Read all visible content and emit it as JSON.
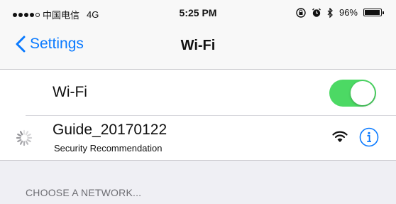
{
  "status_bar": {
    "carrier": "中国电信",
    "network_type": "4G",
    "time": "5:25 PM",
    "battery_percent": "96%",
    "battery_level": 0.96,
    "signal_bars_filled": 4,
    "signal_bars_total": 5,
    "icons": [
      "lock-rotation-icon",
      "alarm-icon",
      "bluetooth-icon",
      "battery-icon"
    ]
  },
  "nav": {
    "back_label": "Settings",
    "title": "Wi-Fi"
  },
  "wifi": {
    "label": "Wi-Fi",
    "enabled": true
  },
  "current_network": {
    "name": "Guide_20170122",
    "subtitle": "Security Recommendation",
    "status": "connecting"
  },
  "section": {
    "choose_network": "CHOOSE A NETWORK..."
  },
  "colors": {
    "accent": "#0a7aff",
    "toggle_on": "#4cd964",
    "grouped_background": "#efeff4"
  }
}
